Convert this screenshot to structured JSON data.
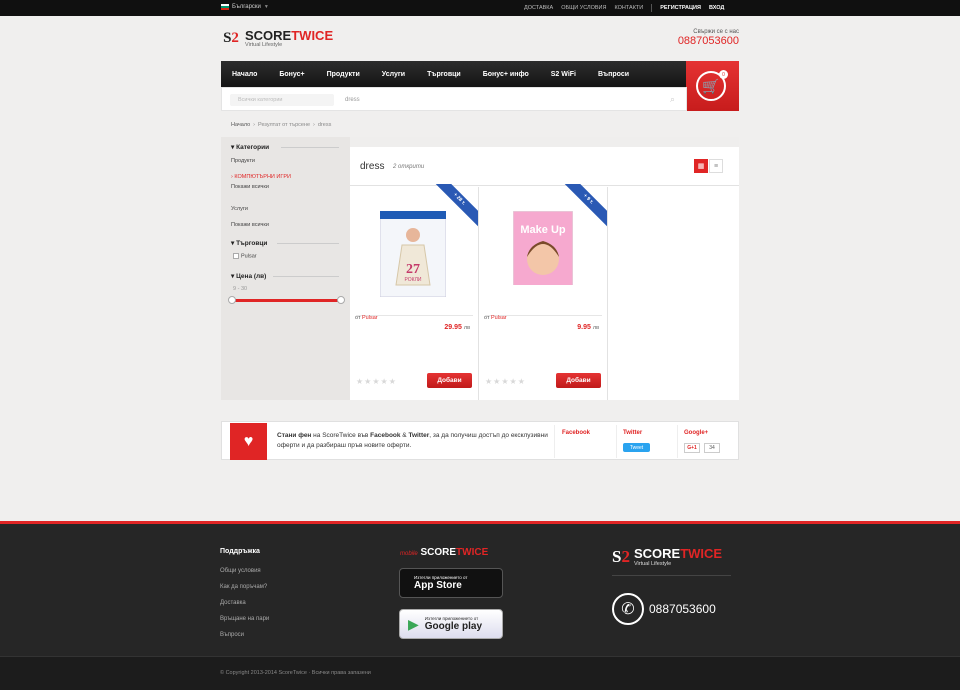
{
  "topbar": {
    "language": "Български",
    "links": [
      "ДОСТАВКА",
      "ОБЩИ УСЛОВИЯ",
      "КОНТАКТИ"
    ],
    "register": "РЕГИСТРАЦИЯ",
    "login": "ВХОД"
  },
  "logo": {
    "mark_a": "S",
    "mark_b": "2",
    "name_a": "SCORE",
    "name_b": "TWICE",
    "tagline": "Virtual Lifestyle"
  },
  "contact": {
    "label": "Свържи се с нас",
    "phone": "0887053600"
  },
  "nav": {
    "items": [
      "Начало",
      "Бонус+",
      "Продукти",
      "Услуги",
      "Търговци",
      "Бонус+ инфо",
      "S2 WiFi",
      "Въпроси"
    ]
  },
  "cart": {
    "count": "0"
  },
  "search": {
    "category_placeholder": "Всички категории",
    "query": "dress"
  },
  "breadcrumb": {
    "home": "Начало",
    "results": "Резултат от търсене",
    "query": "dress"
  },
  "sidebar": {
    "categories_title": "Категории",
    "products": "Продукти",
    "computer_games": "КОМПЮТЪРНИ ИГРИ",
    "show_all_1": "Покажи всички",
    "services": "Услуги",
    "show_all_2": "Покажи всички",
    "merchants_title": "Търговци",
    "merchant": "Pulsar",
    "price_title": "Цена (лв)",
    "price_range": "9 - 30"
  },
  "results": {
    "title": "dress",
    "count": "2 открити",
    "products": [
      {
        "badge": "+ 28 т.",
        "brand_prefix": "от",
        "brand": "Pulsar",
        "price": "29.95",
        "currency": "лв",
        "button": "Добави",
        "cover_title": "27",
        "cover_sub": "РОКЛИ"
      },
      {
        "badge": "+ 9 т.",
        "brand_prefix": "от",
        "brand": "Pulsar",
        "price": "9.95",
        "currency": "лв",
        "button": "Добави",
        "cover_title": "Make Up",
        "cover_sub": ""
      }
    ]
  },
  "social": {
    "t1": "Стани фен",
    "t2": " на ScoreTwice във ",
    "t3": "Facebook",
    "t4": " & ",
    "t5": "Twitter",
    "t6": ", за да получиш достъп до ексклузивни оферти и да разбираш пръв новите оферти.",
    "facebook": "Facebook",
    "twitter": "Twitter",
    "tweet_btn": "Tweet",
    "googleplus": "Google+",
    "gplus_btn": "G+1",
    "gplus_count": "34"
  },
  "footer": {
    "support_title": "Поддръжка",
    "links": [
      "Общи условия",
      "Как да поръчам?",
      "Доставка",
      "Връщане на пари",
      "Въпроси"
    ],
    "mobile_prefix": "mobile",
    "mobile_a": "SCORE",
    "mobile_b": "TWICE",
    "appstore_small": "Изтегли приложението от",
    "appstore_big": "App Store",
    "gplay_small": "Изтегли приложението от",
    "gplay_big": "Google play",
    "phone": "0887053600",
    "copyright": "© Copyright 2013-2014 ScoreTwice · Всички права запазени"
  }
}
